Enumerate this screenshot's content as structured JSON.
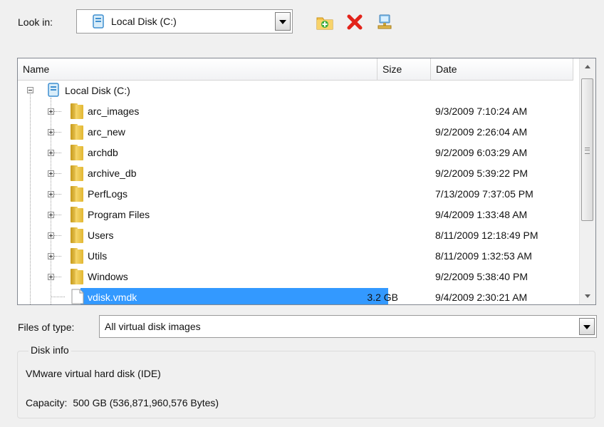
{
  "look_in": {
    "label": "Look in:",
    "selected": "Local Disk (C:)"
  },
  "toolbar": {
    "new_folder_icon": "new-folder-icon",
    "delete_icon": "delete-icon",
    "network_icon": "network-drive-icon"
  },
  "file_list": {
    "columns": [
      "Name",
      "Size",
      "Date"
    ],
    "root": "Local Disk (C:)",
    "items": [
      {
        "name": "arc_images",
        "type": "folder",
        "size": "",
        "date": "9/3/2009 7:10:24 AM"
      },
      {
        "name": "arc_new",
        "type": "folder",
        "size": "",
        "date": "9/2/2009 2:26:04 AM"
      },
      {
        "name": "archdb",
        "type": "folder",
        "size": "",
        "date": "9/2/2009 6:03:29 AM"
      },
      {
        "name": "archive_db",
        "type": "folder",
        "size": "",
        "date": "9/2/2009 5:39:22 PM"
      },
      {
        "name": "PerfLogs",
        "type": "folder",
        "size": "",
        "date": "7/13/2009 7:37:05 PM"
      },
      {
        "name": "Program Files",
        "type": "folder",
        "size": "",
        "date": "9/4/2009 1:33:48 AM"
      },
      {
        "name": "Users",
        "type": "folder",
        "size": "",
        "date": "8/11/2009 12:18:49 PM"
      },
      {
        "name": "Utils",
        "type": "folder",
        "size": "",
        "date": "8/11/2009 1:32:53 AM"
      },
      {
        "name": "Windows",
        "type": "folder",
        "size": "",
        "date": "9/2/2009 5:38:40 PM"
      },
      {
        "name": "vdisk.vmdk",
        "type": "file",
        "size": "3.2 GB",
        "date": "9/4/2009 2:30:21 AM"
      }
    ]
  },
  "files_of_type": {
    "label": "Files of type:",
    "selected": "All virtual disk images"
  },
  "disk_info": {
    "title": "Disk info",
    "description": "VMware virtual hard disk (IDE)",
    "capacity_label": "Capacity:",
    "capacity_value": "500 GB (536,871,960,576 Bytes)"
  },
  "colors": {
    "selection": "#3399ff",
    "window_bg": "#f0f0f0"
  }
}
